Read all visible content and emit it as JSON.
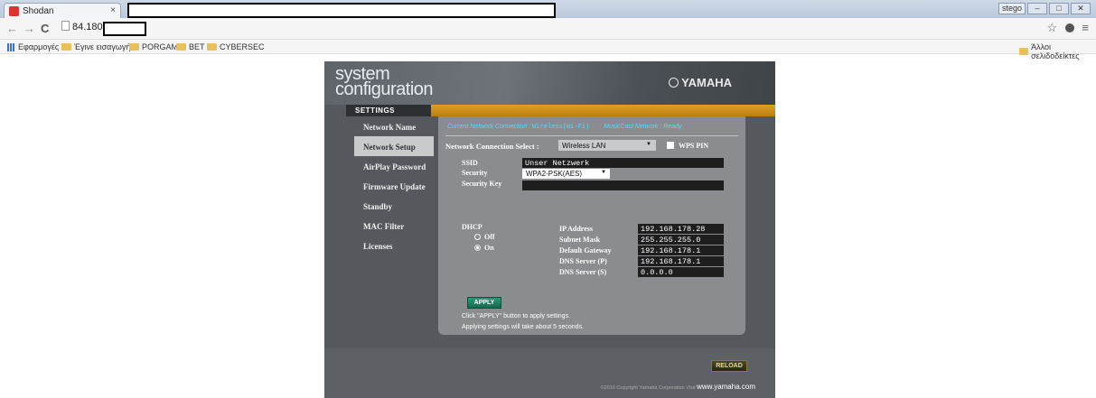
{
  "browser": {
    "tab_title": "Shodan",
    "tab_close": "×",
    "url": "84.180",
    "nav_back": "←",
    "nav_forward": "→",
    "nav_reload": "C",
    "star": "☆",
    "menu": "≡",
    "window_user": "stego",
    "window_min": "–",
    "window_max": "□",
    "window_close": "✕",
    "bookmarks": [
      "Εφαρμογές",
      "Έγινε εισαγωγή",
      "PORGAM",
      "BET",
      "CYBERSEC"
    ],
    "other_bookmarks": "Άλλοι σελιδοδείκτες"
  },
  "header": {
    "line1": "system",
    "line2": "configuration",
    "brand": "YAMAHA",
    "settings_label": "SETTINGS"
  },
  "sidebar": {
    "items": [
      {
        "label": "Network Name",
        "active": false
      },
      {
        "label": "Network Setup",
        "active": true
      },
      {
        "label": "AirPlay Password",
        "active": false
      },
      {
        "label": "Firmware Update",
        "active": false
      },
      {
        "label": "Standby",
        "active": false
      },
      {
        "label": "MAC Filter",
        "active": false
      },
      {
        "label": "Licenses",
        "active": false
      }
    ]
  },
  "status": {
    "current_label": "Current Network Connection :",
    "current_value": "Wireless(Wi-Fi)",
    "musiccast_label": "MusicCast Network :",
    "musiccast_value": "Ready"
  },
  "form": {
    "connection_select_label": "Network Connection Select :",
    "connection_select_value": "Wireless LAN",
    "wps_label": "WPS PIN",
    "ssid_label": "SSID",
    "ssid_value": "Unser Netzwerk",
    "security_label": "Security",
    "security_value": "WPA2-PSK(AES)",
    "security_key_label": "Security Key",
    "security_key_value": "",
    "dhcp_label": "DHCP",
    "dhcp_off": "Off",
    "dhcp_on": "On",
    "ip_label": "IP Address",
    "ip_value": "192.168.178.28",
    "subnet_label": "Subnet Mask",
    "subnet_value": "255.255.255.0",
    "gateway_label": "Default Gateway",
    "gateway_value": "192.168.178.1",
    "dns_p_label": "DNS Server (P)",
    "dns_p_value": "192.168.178.1",
    "dns_s_label": "DNS Server (S)",
    "dns_s_value": "0.0.0.0",
    "apply_label": "APPLY",
    "note1": "Click \"APPLY\" button to apply settings.",
    "note2": "Applying settings will take about 5 seconds."
  },
  "footer": {
    "reload_label": "RELOAD",
    "copyright": "©2016 Copyright Yamaha Corporation Visit",
    "site": "www.yamaha.com"
  },
  "colors": {
    "accent_orange": "#d4961e",
    "status_cyan": "#58d8ff",
    "apply_green": "#1e8a6a"
  }
}
